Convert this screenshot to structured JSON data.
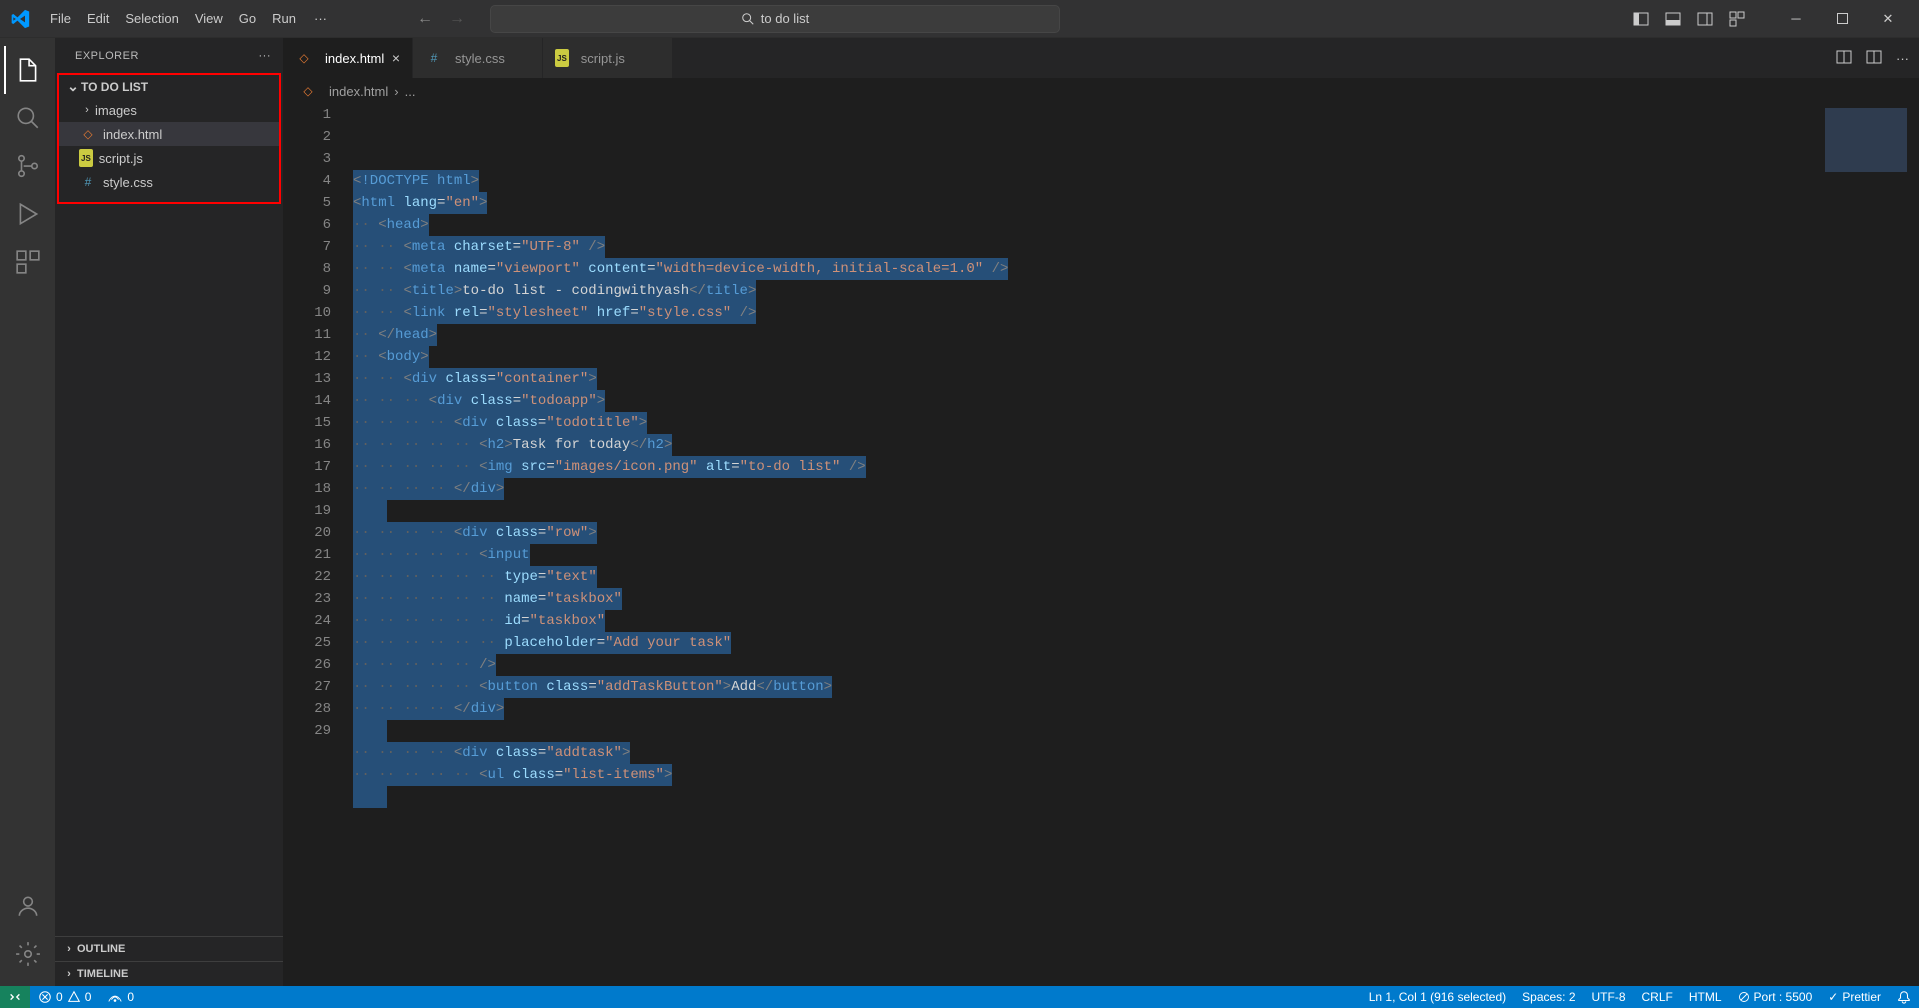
{
  "titlebar": {
    "menu": [
      "File",
      "Edit",
      "Selection",
      "View",
      "Go",
      "Run"
    ],
    "search_text": "to do list"
  },
  "sidebar": {
    "title": "EXPLORER",
    "folder_name": "TO DO LIST",
    "files": [
      {
        "name": "images",
        "type": "folder"
      },
      {
        "name": "index.html",
        "type": "html",
        "active": true
      },
      {
        "name": "script.js",
        "type": "js"
      },
      {
        "name": "style.css",
        "type": "css"
      }
    ],
    "outline": "OUTLINE",
    "timeline": "TIMELINE"
  },
  "tabs": [
    {
      "name": "index.html",
      "type": "html",
      "active": true,
      "closable": true
    },
    {
      "name": "style.css",
      "type": "css"
    },
    {
      "name": "script.js",
      "type": "js"
    }
  ],
  "breadcrumb": {
    "file": "index.html",
    "symbol": "..."
  },
  "editor": {
    "lines": [
      {
        "num": 1,
        "indent": 0,
        "tokens": [
          [
            "bracket",
            "<"
          ],
          [
            "doctype",
            "!DOCTYPE"
          ],
          [
            "text",
            " "
          ],
          [
            "tag",
            "html"
          ],
          [
            "bracket",
            ">"
          ]
        ]
      },
      {
        "num": 2,
        "indent": 0,
        "tokens": [
          [
            "bracket",
            "<"
          ],
          [
            "tag",
            "html"
          ],
          [
            "text",
            " "
          ],
          [
            "attr",
            "lang"
          ],
          [
            "text",
            "="
          ],
          [
            "str",
            "\"en\""
          ],
          [
            "bracket",
            ">"
          ]
        ]
      },
      {
        "num": 3,
        "indent": 1,
        "tokens": [
          [
            "bracket",
            "<"
          ],
          [
            "tag",
            "head"
          ],
          [
            "bracket",
            ">"
          ]
        ]
      },
      {
        "num": 4,
        "indent": 2,
        "tokens": [
          [
            "bracket",
            "<"
          ],
          [
            "tag",
            "meta"
          ],
          [
            "text",
            " "
          ],
          [
            "attr",
            "charset"
          ],
          [
            "text",
            "="
          ],
          [
            "str",
            "\"UTF-8\""
          ],
          [
            "text",
            " "
          ],
          [
            "bracket",
            "/>"
          ]
        ]
      },
      {
        "num": 5,
        "indent": 2,
        "tokens": [
          [
            "bracket",
            "<"
          ],
          [
            "tag",
            "meta"
          ],
          [
            "text",
            " "
          ],
          [
            "attr",
            "name"
          ],
          [
            "text",
            "="
          ],
          [
            "str",
            "\"viewport\""
          ],
          [
            "text",
            " "
          ],
          [
            "attr",
            "content"
          ],
          [
            "text",
            "="
          ],
          [
            "str",
            "\"width=device-width, initial-scale=1.0\""
          ],
          [
            "text",
            " "
          ],
          [
            "bracket",
            "/>"
          ]
        ]
      },
      {
        "num": 6,
        "indent": 2,
        "tokens": [
          [
            "bracket",
            "<"
          ],
          [
            "tag",
            "title"
          ],
          [
            "bracket",
            ">"
          ],
          [
            "text",
            "to-do list - codingwithyash"
          ],
          [
            "bracket",
            "</"
          ],
          [
            "tag",
            "title"
          ],
          [
            "bracket",
            ">"
          ]
        ]
      },
      {
        "num": 7,
        "indent": 2,
        "tokens": [
          [
            "bracket",
            "<"
          ],
          [
            "tag",
            "link"
          ],
          [
            "text",
            " "
          ],
          [
            "attr",
            "rel"
          ],
          [
            "text",
            "="
          ],
          [
            "str",
            "\"stylesheet\""
          ],
          [
            "text",
            " "
          ],
          [
            "attr",
            "href"
          ],
          [
            "text",
            "="
          ],
          [
            "str",
            "\"style.css\""
          ],
          [
            "text",
            " "
          ],
          [
            "bracket",
            "/>"
          ]
        ]
      },
      {
        "num": 8,
        "indent": 1,
        "tokens": [
          [
            "bracket",
            "</"
          ],
          [
            "tag",
            "head"
          ],
          [
            "bracket",
            ">"
          ]
        ]
      },
      {
        "num": 9,
        "indent": 1,
        "tokens": [
          [
            "bracket",
            "<"
          ],
          [
            "tag",
            "body"
          ],
          [
            "bracket",
            ">"
          ]
        ]
      },
      {
        "num": 10,
        "indent": 2,
        "tokens": [
          [
            "bracket",
            "<"
          ],
          [
            "tag",
            "div"
          ],
          [
            "text",
            " "
          ],
          [
            "attr",
            "class"
          ],
          [
            "text",
            "="
          ],
          [
            "str",
            "\"container\""
          ],
          [
            "bracket",
            ">"
          ]
        ]
      },
      {
        "num": 11,
        "indent": 3,
        "tokens": [
          [
            "bracket",
            "<"
          ],
          [
            "tag",
            "div"
          ],
          [
            "text",
            " "
          ],
          [
            "attr",
            "class"
          ],
          [
            "text",
            "="
          ],
          [
            "str",
            "\"todoapp\""
          ],
          [
            "bracket",
            ">"
          ]
        ]
      },
      {
        "num": 12,
        "indent": 4,
        "tokens": [
          [
            "bracket",
            "<"
          ],
          [
            "tag",
            "div"
          ],
          [
            "text",
            " "
          ],
          [
            "attr",
            "class"
          ],
          [
            "text",
            "="
          ],
          [
            "str",
            "\"todotitle\""
          ],
          [
            "bracket",
            ">"
          ]
        ]
      },
      {
        "num": 13,
        "indent": 5,
        "tokens": [
          [
            "bracket",
            "<"
          ],
          [
            "tag",
            "h2"
          ],
          [
            "bracket",
            ">"
          ],
          [
            "text",
            "Task for today"
          ],
          [
            "bracket",
            "</"
          ],
          [
            "tag",
            "h2"
          ],
          [
            "bracket",
            ">"
          ]
        ]
      },
      {
        "num": 14,
        "indent": 5,
        "tokens": [
          [
            "bracket",
            "<"
          ],
          [
            "tag",
            "img"
          ],
          [
            "text",
            " "
          ],
          [
            "attr",
            "src"
          ],
          [
            "text",
            "="
          ],
          [
            "str",
            "\"images/icon.png\""
          ],
          [
            "text",
            " "
          ],
          [
            "attr",
            "alt"
          ],
          [
            "text",
            "="
          ],
          [
            "str",
            "\"to-do list\""
          ],
          [
            "text",
            " "
          ],
          [
            "bracket",
            "/>"
          ]
        ]
      },
      {
        "num": 15,
        "indent": 4,
        "tokens": [
          [
            "bracket",
            "</"
          ],
          [
            "tag",
            "div"
          ],
          [
            "bracket",
            ">"
          ]
        ]
      },
      {
        "num": 16,
        "indent": 0,
        "tokens": []
      },
      {
        "num": 17,
        "indent": 4,
        "tokens": [
          [
            "bracket",
            "<"
          ],
          [
            "tag",
            "div"
          ],
          [
            "text",
            " "
          ],
          [
            "attr",
            "class"
          ],
          [
            "text",
            "="
          ],
          [
            "str",
            "\"row\""
          ],
          [
            "bracket",
            ">"
          ]
        ]
      },
      {
        "num": 18,
        "indent": 5,
        "tokens": [
          [
            "bracket",
            "<"
          ],
          [
            "tag",
            "input"
          ]
        ]
      },
      {
        "num": 19,
        "indent": 6,
        "tokens": [
          [
            "attr",
            "type"
          ],
          [
            "text",
            "="
          ],
          [
            "str",
            "\"text\""
          ]
        ]
      },
      {
        "num": 20,
        "indent": 6,
        "tokens": [
          [
            "attr",
            "name"
          ],
          [
            "text",
            "="
          ],
          [
            "str",
            "\"taskbox\""
          ]
        ]
      },
      {
        "num": 21,
        "indent": 6,
        "tokens": [
          [
            "attr",
            "id"
          ],
          [
            "text",
            "="
          ],
          [
            "str",
            "\"taskbox\""
          ]
        ]
      },
      {
        "num": 22,
        "indent": 6,
        "tokens": [
          [
            "attr",
            "placeholder"
          ],
          [
            "text",
            "="
          ],
          [
            "str",
            "\"Add your task\""
          ]
        ]
      },
      {
        "num": 23,
        "indent": 5,
        "tokens": [
          [
            "bracket",
            "/>"
          ]
        ]
      },
      {
        "num": 24,
        "indent": 5,
        "tokens": [
          [
            "bracket",
            "<"
          ],
          [
            "tag",
            "button"
          ],
          [
            "text",
            " "
          ],
          [
            "attr",
            "class"
          ],
          [
            "text",
            "="
          ],
          [
            "str",
            "\"addTaskButton\""
          ],
          [
            "bracket",
            ">"
          ],
          [
            "text",
            "Add"
          ],
          [
            "bracket",
            "</"
          ],
          [
            "tag",
            "button"
          ],
          [
            "bracket",
            ">"
          ]
        ]
      },
      {
        "num": 25,
        "indent": 4,
        "tokens": [
          [
            "bracket",
            "</"
          ],
          [
            "tag",
            "div"
          ],
          [
            "bracket",
            ">"
          ]
        ]
      },
      {
        "num": 26,
        "indent": 0,
        "tokens": []
      },
      {
        "num": 27,
        "indent": 4,
        "tokens": [
          [
            "bracket",
            "<"
          ],
          [
            "tag",
            "div"
          ],
          [
            "text",
            " "
          ],
          [
            "attr",
            "class"
          ],
          [
            "text",
            "="
          ],
          [
            "str",
            "\"addtask\""
          ],
          [
            "bracket",
            ">"
          ]
        ]
      },
      {
        "num": 28,
        "indent": 5,
        "tokens": [
          [
            "bracket",
            "<"
          ],
          [
            "tag",
            "ul"
          ],
          [
            "text",
            " "
          ],
          [
            "attr",
            "class"
          ],
          [
            "text",
            "="
          ],
          [
            "str",
            "\"list-items\""
          ],
          [
            "bracket",
            ">"
          ]
        ]
      },
      {
        "num": 29,
        "indent": 0,
        "tokens": []
      }
    ]
  },
  "statusbar": {
    "errors": "0",
    "warnings": "0",
    "radio": "0",
    "position": "Ln 1, Col 1 (916 selected)",
    "spaces": "Spaces: 2",
    "encoding": "UTF-8",
    "eol": "CRLF",
    "language": "HTML",
    "port": "Port : 5500",
    "prettier": "Prettier"
  }
}
